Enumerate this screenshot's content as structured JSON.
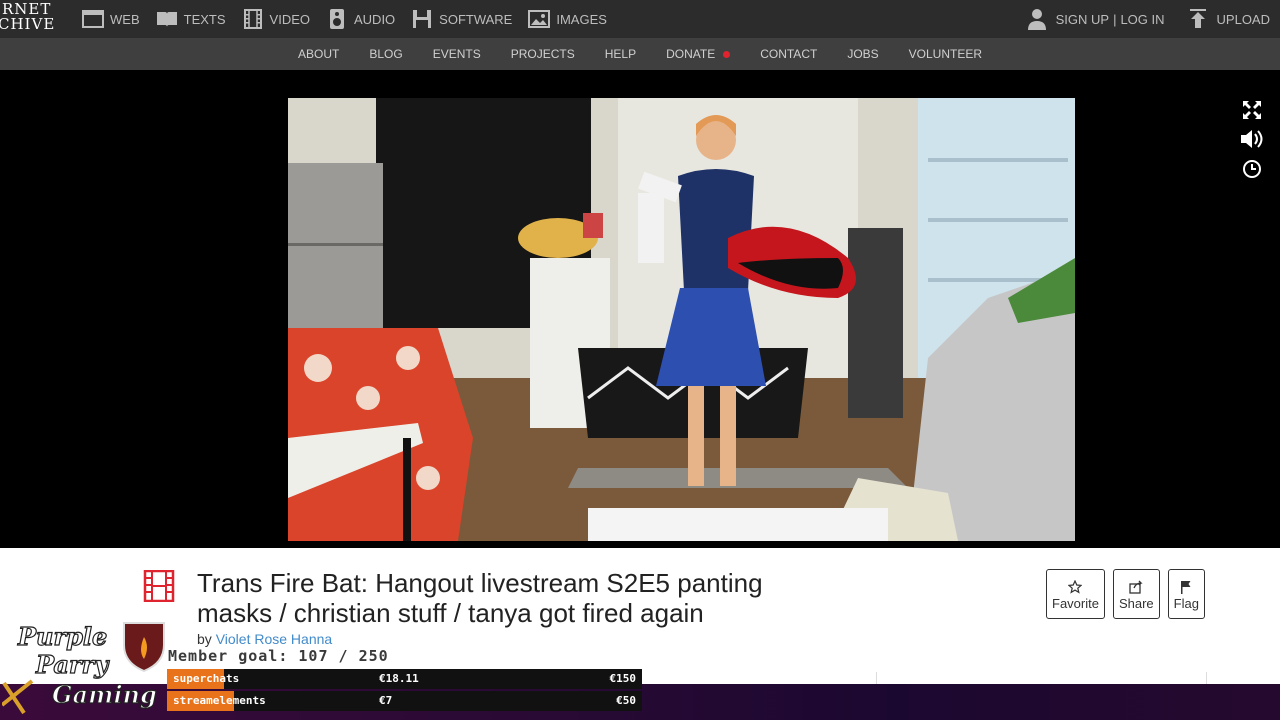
{
  "logo": {
    "line1": "ERNET",
    "line2": "CHIVE"
  },
  "media_nav": [
    {
      "label": "WEB",
      "icon": "web-icon"
    },
    {
      "label": "TEXTS",
      "icon": "book-icon"
    },
    {
      "label": "VIDEO",
      "icon": "film-icon"
    },
    {
      "label": "AUDIO",
      "icon": "speaker-icon"
    },
    {
      "label": "SOFTWARE",
      "icon": "floppy-icon"
    },
    {
      "label": "IMAGES",
      "icon": "image-icon"
    }
  ],
  "account": {
    "signup": "SIGN UP",
    "separator": "|",
    "login": "LOG IN",
    "upload": "UPLOAD"
  },
  "subnav": [
    "ABOUT",
    "BLOG",
    "EVENTS",
    "PROJECTS",
    "HELP",
    "DONATE",
    "CONTACT",
    "JOBS",
    "VOLUNTEER"
  ],
  "item": {
    "title": "Trans Fire Bat: Hangout livestream S2E5 panting masks / christian stuff / tanya got fired again",
    "by_label": "by",
    "author": "Violet Rose Hanna"
  },
  "actions": {
    "favorite": "Favorite",
    "share": "Share",
    "flag": "Flag"
  },
  "overlay": {
    "channel_logo_text": [
      "Purple",
      "Parry",
      "Gaming"
    ],
    "member_goal": "Member goal: 107 / 250",
    "bars": [
      {
        "label": "superchats",
        "current": "€18.11",
        "target": "€150",
        "progress": 0.12
      },
      {
        "label": "streamelements",
        "current": "€7",
        "target": "€50",
        "progress": 0.14
      }
    ]
  },
  "colors": {
    "accent_link": "#428bca",
    "donate_dot": "#e0242f",
    "goal_fill": "#e8731b",
    "film_icon": "#e0242f"
  }
}
